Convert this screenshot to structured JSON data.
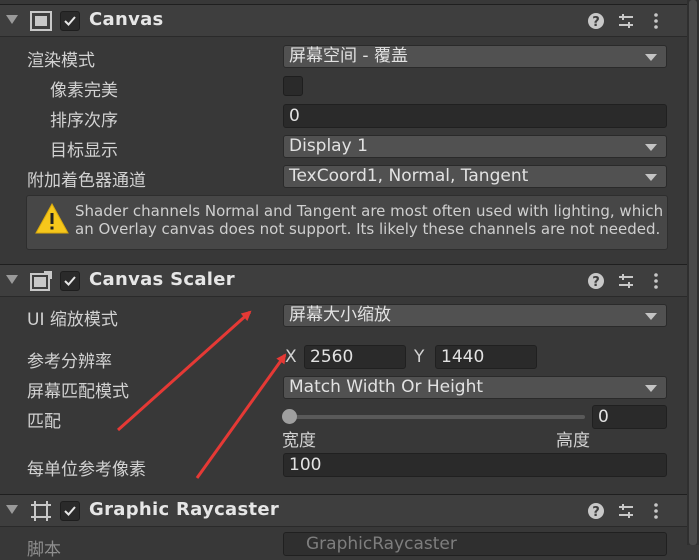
{
  "canvas": {
    "title": "Canvas",
    "render_mode_label": "渲染模式",
    "render_mode_value": "屏幕空间 - 覆盖",
    "pixel_perfect_label": "像素完美",
    "sort_order_label": "排序次序",
    "sort_order_value": "0",
    "target_display_label": "目标显示",
    "target_display_value": "Display 1",
    "additional_channels_label": "附加着色器通道",
    "additional_channels_value": "TexCoord1, Normal, Tangent",
    "help_text": "Shader channels Normal and Tangent are most often used with lighting, which an Overlay canvas does not support. Its likely these channels are not needed."
  },
  "scaler": {
    "title": "Canvas Scaler",
    "ui_scale_mode_label": "UI 缩放模式",
    "ui_scale_mode_value": "屏幕大小缩放",
    "ref_resolution_label": "参考分辨率",
    "x_label": "X",
    "x_value": "2560",
    "y_label": "Y",
    "y_value": "1440",
    "screen_match_mode_label": "屏幕匹配模式",
    "screen_match_mode_value": "Match Width Or Height",
    "match_label": "匹配",
    "match_value": "0",
    "width_label": "宽度",
    "height_label": "高度",
    "ref_pixels_label": "每单位参考像素",
    "ref_pixels_value": "100"
  },
  "raycaster": {
    "title": "Graphic Raycaster",
    "script_label": "脚本",
    "script_value": "GraphicRaycaster"
  },
  "colors": {
    "background": "#383838",
    "header": "#3e3e3e",
    "annotation_arrow": "#e53935",
    "warning": "#f6c71b"
  },
  "icons": [
    "fold-icon",
    "canvas-icon",
    "checkmark-icon",
    "help-icon",
    "preset-icon",
    "kebab-menu-icon",
    "warning-icon",
    "raycaster-icon"
  ]
}
